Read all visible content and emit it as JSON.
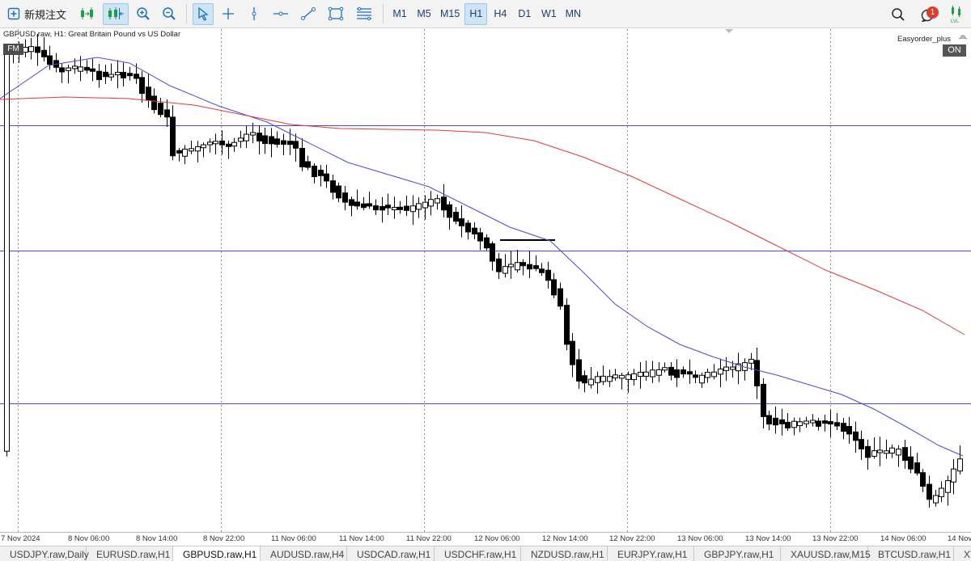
{
  "toolbar": {
    "new_order_label": "新規注文",
    "timeframes": [
      "M1",
      "M5",
      "M15",
      "H1",
      "H4",
      "D1",
      "W1",
      "MN"
    ],
    "active_timeframe": "H1",
    "notification_count": "1",
    "accent_color": "#1a6fc4"
  },
  "chart": {
    "title": "GBPUSD.raw, H1:  Great Britain Pound vs US Dollar",
    "fm_badge": "FM",
    "expert_name": "Easyorder_plus",
    "expert_status": "ON",
    "bull_candle_color": "#ffffff",
    "bear_candle_color": "#000000",
    "fast_ma_color": "#4a4ad6",
    "slow_ma_color": "#e03a3a",
    "hline_color": "#4a4ad6"
  },
  "time_axis": [
    "7 Nov 2024",
    "8 Nov 06:00",
    "8 Nov 14:00",
    "8 Nov 22:00",
    "11 Nov 06:00",
    "11 Nov 14:00",
    "11 Nov 22:00",
    "12 Nov 06:00",
    "12 Nov 14:00",
    "12 Nov 22:00",
    "13 Nov 06:00",
    "13 Nov 14:00",
    "13 Nov 22:00",
    "14 Nov 06:00",
    "14 Nov"
  ],
  "tabs": [
    "USDJPY.raw,Daily",
    "EURUSD.raw,H1",
    "GBPUSD.raw,H1",
    "AUDUSD.raw,H4",
    "USDCAD.raw,H1",
    "USDCHF.raw,H1",
    "NZDUSD.raw,H1",
    "EURJPY.raw,H1",
    "GBPJPY.raw,H1",
    "XAUUSD.raw,M15",
    "BTCUSD.raw,H1",
    "XTI"
  ],
  "active_tab": "GBPUSD.raw,H1"
}
